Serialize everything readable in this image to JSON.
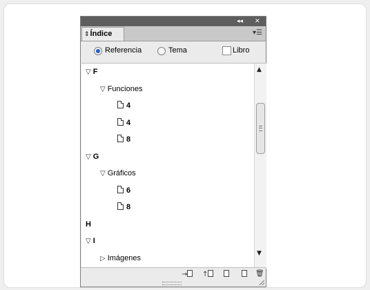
{
  "panel": {
    "title_buttons": {
      "collapse": "◂◂",
      "close": "✕"
    },
    "tab_label": "Índice",
    "menu_icon": "panel-menu-icon"
  },
  "options": {
    "referencia": {
      "label": "Referencia",
      "selected": true
    },
    "tema": {
      "label": "Tema",
      "selected": false
    },
    "libro": {
      "label": "Libro",
      "checked": false
    }
  },
  "index_entries": [
    {
      "label": "F",
      "level": 0,
      "type": "letter",
      "expanded": true
    },
    {
      "label": "Funciones",
      "level": 1,
      "type": "topic",
      "expanded": true
    },
    {
      "label": "4",
      "level": 2,
      "type": "page"
    },
    {
      "label": "4",
      "level": 2,
      "type": "page"
    },
    {
      "label": "8",
      "level": 2,
      "type": "page"
    },
    {
      "label": "G",
      "level": 0,
      "type": "letter",
      "expanded": true
    },
    {
      "label": "Gráficos",
      "level": 1,
      "type": "topic",
      "expanded": true
    },
    {
      "label": "6",
      "level": 2,
      "type": "page"
    },
    {
      "label": "8",
      "level": 2,
      "type": "page"
    },
    {
      "label": "H",
      "level": 0,
      "type": "letter",
      "expanded": null
    },
    {
      "label": "I",
      "level": 0,
      "type": "letter",
      "expanded": true
    },
    {
      "label": "Imágenes",
      "level": 1,
      "type": "topic",
      "expanded": false
    }
  ],
  "scrollbar": {
    "position_fraction": 0.4
  },
  "toolbar": [
    {
      "name": "go-to-selected-marker-icon"
    },
    {
      "name": "update-preview-icon"
    },
    {
      "name": "generate-index-icon"
    },
    {
      "name": "new-index-entry-icon"
    },
    {
      "name": "delete-entry-icon"
    }
  ],
  "colors": {
    "accent": "#1d5fc9",
    "titlebar": "#5e5e5e",
    "panel": "#ebebeb"
  }
}
